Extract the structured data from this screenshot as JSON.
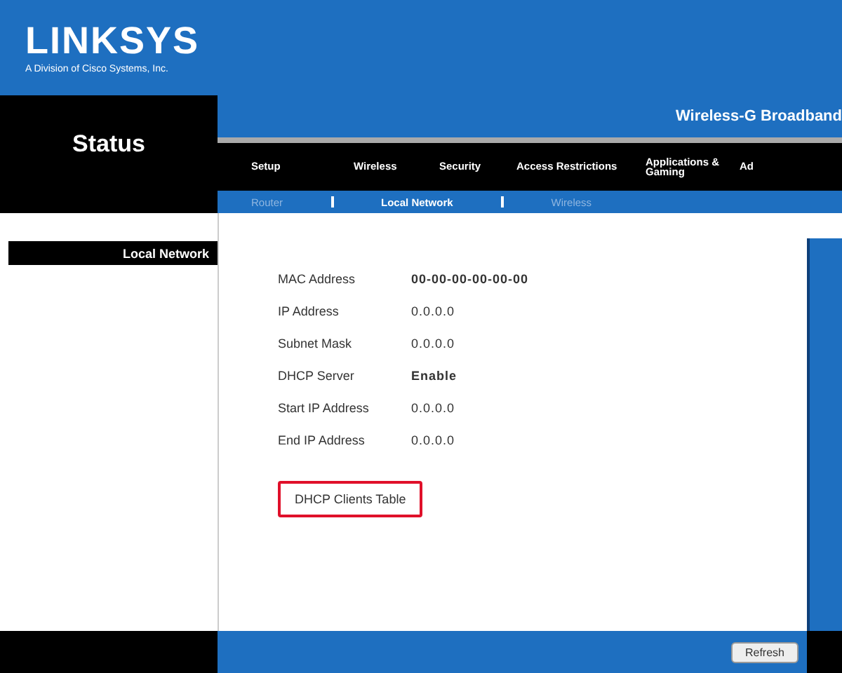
{
  "brand": {
    "logo": "LINKSYS",
    "tagline": "A Division of Cisco Systems, Inc."
  },
  "section": "Status",
  "product": "Wireless-G Broadband",
  "tabs": [
    {
      "label": "Setup",
      "selected": false
    },
    {
      "label": "Wireless",
      "selected": false
    },
    {
      "label": "Security",
      "selected": false
    },
    {
      "label": "Access Restrictions",
      "selected": false
    },
    {
      "label": "Applications & Gaming",
      "selected": false
    },
    {
      "label": "Ad",
      "selected": false
    }
  ],
  "subtabs": [
    {
      "label": "Router",
      "selected": false
    },
    {
      "label": "Local Network",
      "selected": true
    },
    {
      "label": "Wireless",
      "selected": false
    }
  ],
  "sidebar": {
    "heading": "Local Network"
  },
  "fields": [
    {
      "label": "MAC Address",
      "value": "00-00-00-00-00-00",
      "bold": true
    },
    {
      "label": "IP Address",
      "value": "0.0.0.0",
      "bold": false
    },
    {
      "label": "Subnet Mask",
      "value": "0.0.0.0",
      "bold": false
    },
    {
      "label": "DHCP Server",
      "value": "Enable",
      "bold": true
    },
    {
      "label": "Start IP Address",
      "value": "0.0.0.0",
      "bold": false
    },
    {
      "label": "End IP Address",
      "value": "0.0.0.0",
      "bold": false
    }
  ],
  "clients_button": {
    "label": "DHCP Clients Table",
    "highlighted": true
  },
  "refresh_button": {
    "label": "Refresh"
  }
}
